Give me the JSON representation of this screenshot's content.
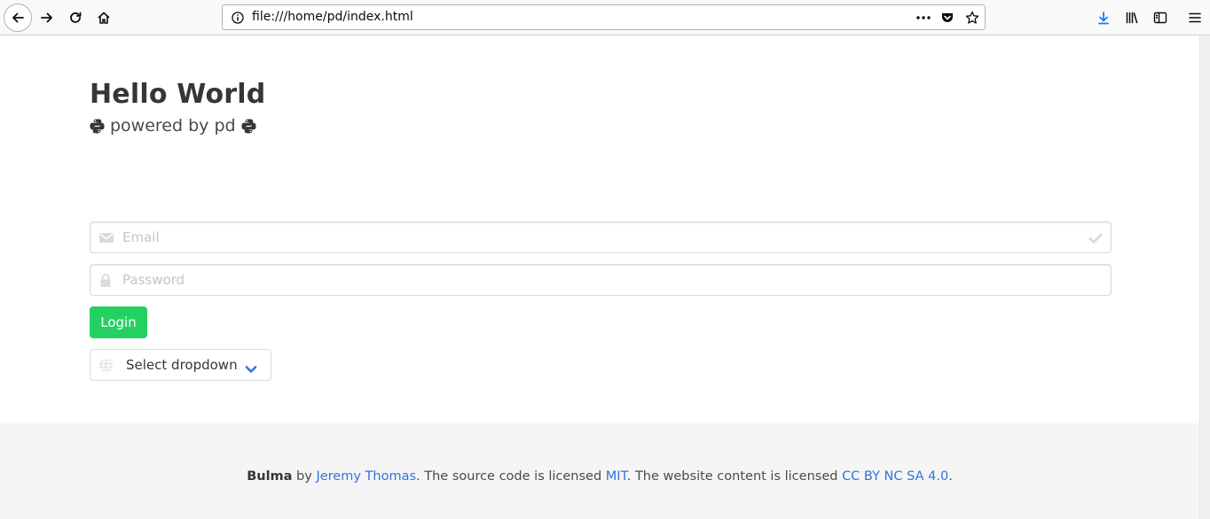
{
  "browser": {
    "url": "file:///home/pd/index.html",
    "icons": [
      "back-icon",
      "forward-icon",
      "reload-icon",
      "home-icon",
      "info-icon",
      "page-actions-icon",
      "pocket-icon",
      "bookmark-star-icon",
      "downloads-icon",
      "library-icon",
      "sidebar-icon",
      "menu-icon"
    ]
  },
  "hero": {
    "title": "Hello World",
    "subtitle": "powered by pd"
  },
  "form": {
    "email_placeholder": "Email",
    "password_placeholder": "Password",
    "login_label": "Login",
    "select_label": "Select dropdown"
  },
  "footer": {
    "brand": "Bulma",
    "by": " by ",
    "author": "Jeremy Thomas",
    "text1": ". The source code is licensed ",
    "license_code": "MIT",
    "text2": ". The website content is licensed ",
    "license_content": "CC BY NC SA 4.0",
    "text3": "."
  },
  "colors": {
    "primary": "#23d160",
    "link": "#3273dc",
    "download_accent": "#0a84ff"
  }
}
